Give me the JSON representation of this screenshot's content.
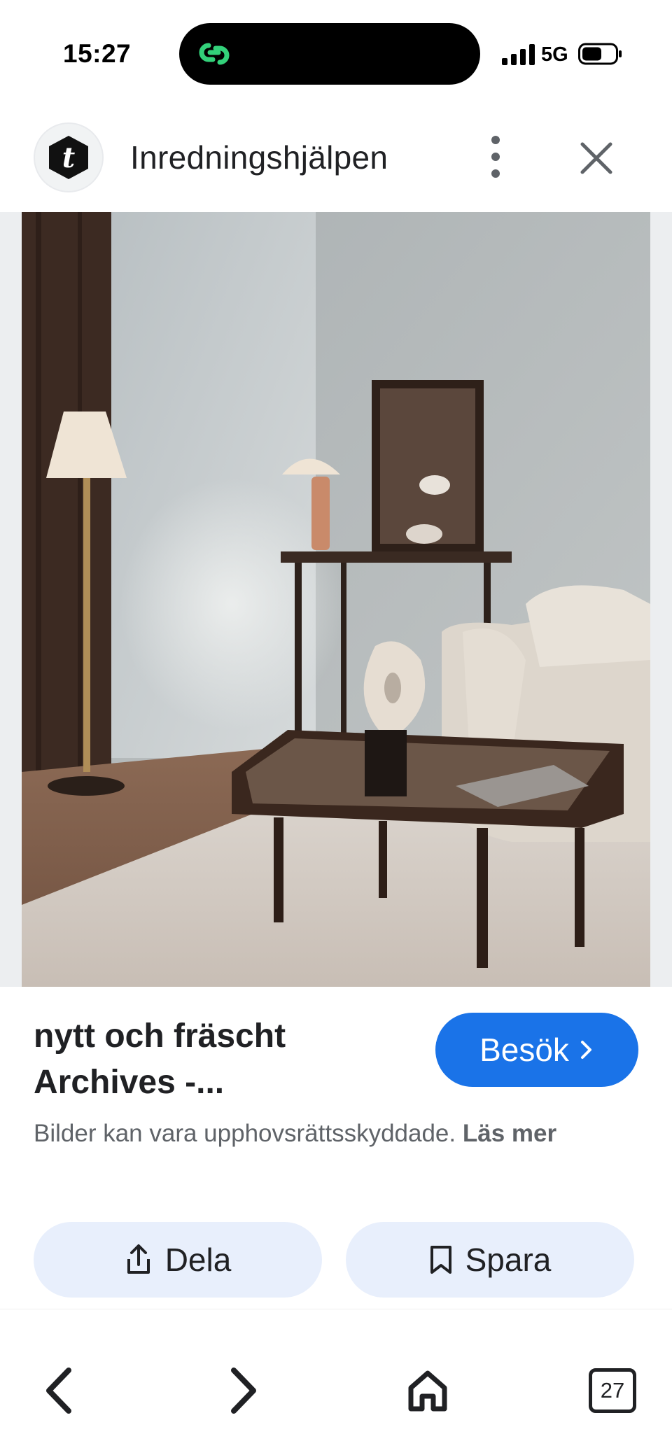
{
  "status_bar": {
    "time": "15:27",
    "network": "5G",
    "icons": [
      "signal-icon",
      "battery-icon",
      "chat-link-icon"
    ]
  },
  "header": {
    "site_name": "Inredningshjälpen",
    "logo_letter": "t",
    "icons": [
      "more-vert-icon",
      "close-icon"
    ]
  },
  "result": {
    "title": "nytt och fräscht Archives -...",
    "visit_label": "Besök",
    "copyright_text": "Bilder kan vara upphovsrättsskyddade.",
    "learn_more": "Läs mer"
  },
  "actions": {
    "share_label": "Dela",
    "save_label": "Spara"
  },
  "toolbar": {
    "tab_count": "27",
    "icons": [
      "back-icon",
      "forward-icon",
      "home-icon",
      "tabs-icon"
    ]
  },
  "colors": {
    "accent": "#1a73e8",
    "action_bg": "#e8effc",
    "island_icon": "#2ecc71"
  }
}
